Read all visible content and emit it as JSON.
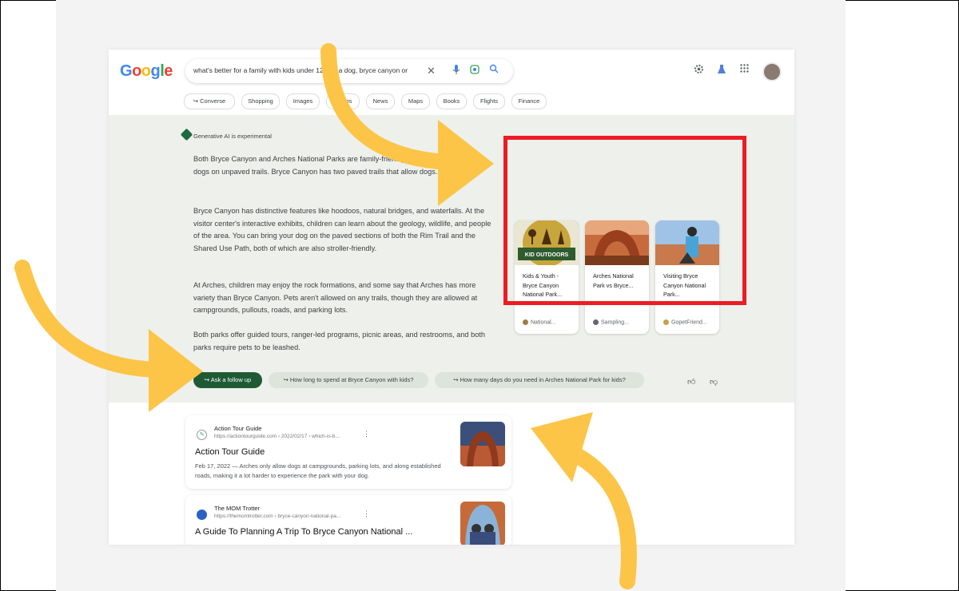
{
  "search": {
    "query": "what's better for a family with kids under 12 and a dog, bryce canyon or"
  },
  "header": {
    "logo": [
      "G",
      "o",
      "o",
      "g",
      "l",
      "e"
    ],
    "logo_colors": [
      "#4285F4",
      "#EA4335",
      "#FBBC05",
      "#4285F4",
      "#34A853",
      "#EA4335"
    ],
    "icons": [
      "settings-icon",
      "labs-icon",
      "apps-icon"
    ]
  },
  "tabs": [
    "↪ Converse",
    "Shopping",
    "Images",
    "Videos",
    "News",
    "Maps",
    "Books",
    "Flights",
    "Finance"
  ],
  "ai": {
    "badge": "Generative AI is experimental",
    "paragraphs": [
      "Both Bryce Canyon and Arches National Parks are family-friendly, but both parks prohibit dogs on unpaved trails. Bryce Canyon has two paved trails that allow dogs.",
      "Bryce Canyon has distinctive features like hoodoos, natural bridges, and waterfalls. At the visitor center's interactive exhibits, children can learn about the geology, wildlife, and people of the area. You can bring your dog on the paved sections of both the Rim Trail and the Shared Use Path, both of which are also stroller-friendly.",
      "At Arches, children may enjoy the rock formations, and some say that Arches has more variety than Bryce Canyon. Pets aren't allowed on any trails, though they are allowed at campgrounds, pullouts, roads, and parking lots.",
      "Both parks offer guided tours, ranger-led programs, picnic areas, and restrooms, and both parks require pets to be leashed."
    ],
    "followup_primary": "↪ Ask a follow up",
    "followup_chips": [
      "↪ How long to spend at Bryce Canyon with kids?",
      "↪ How many days do you need in Arches National Park for kids?"
    ]
  },
  "cards": [
    {
      "title": "Kids & Youth - Bryce Canyon National Park...",
      "source": "National...",
      "image_label": "KID OUTDOORS"
    },
    {
      "title": "Arches National Park vs Bryce...",
      "source": "Sampling...",
      "image_label": ""
    },
    {
      "title": "Visiting Bryce Canyon National Park...",
      "source": "GopetFriend...",
      "image_label": ""
    }
  ],
  "results": [
    {
      "site": "Action Tour Guide",
      "url": "https://actiontourguide.com › 2022/02/17 › which-is-b...",
      "title": "Action Tour Guide",
      "snippet": "Feb 17, 2022 — Arches only allow dogs at campgrounds, parking lots, and along established roads, making it a lot harder to experience the park with your dog."
    },
    {
      "site": "The MOM Trotter",
      "url": "https://themomtrotter.com › bryce-canyon-national-pa...",
      "title": "A Guide To Planning A Trip To Bryce Canyon National ...",
      "snippet": ""
    }
  ],
  "annotation": {
    "arrow_color": "#FCC548",
    "box_color": "#EC1C24"
  }
}
